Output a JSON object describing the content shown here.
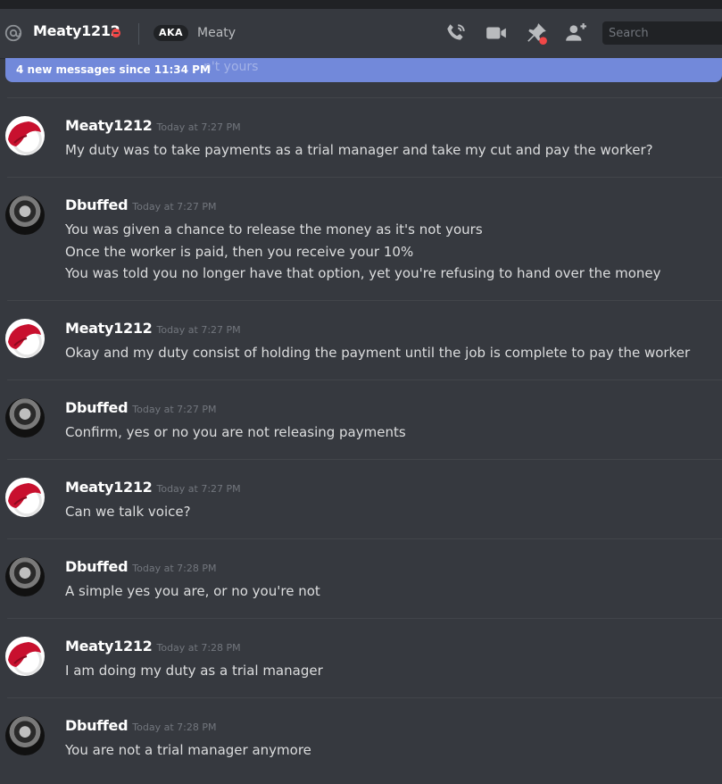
{
  "header": {
    "title": "Meaty1212",
    "aka_badge": "AKA",
    "aka_name": "Meaty",
    "status_color": "#f04747",
    "icons": [
      "at-icon",
      "start-voice-call-icon",
      "start-video-call-icon",
      "pinned-messages-icon",
      "add-friends-to-dm-icon"
    ],
    "search_placeholder": "Search"
  },
  "new_messages_bar": {
    "text": "4 new messages since 11:34 PM",
    "ghost_text": "n't yours",
    "color": "#7289da"
  },
  "messages": [
    {
      "author": "Meaty1212",
      "time": "Today at 7:27 PM",
      "avatar": "santa-hat-avatar",
      "lines": [
        "My duty was to take payments as a trial manager and take my cut and pay the worker?"
      ]
    },
    {
      "author": "Dbuffed",
      "time": "Today at 7:27 PM",
      "avatar": "bw-portrait-avatar",
      "lines": [
        "You was given a chance to release the money as it's not yours",
        "Once the worker is paid, then you receive your 10%",
        "You was told you no longer have that option, yet you're refusing to hand over the money"
      ]
    },
    {
      "author": "Meaty1212",
      "time": "Today at 7:27 PM",
      "avatar": "santa-hat-avatar",
      "lines": [
        "Okay and my duty consist of holding the payment until the job is complete to pay the worker"
      ]
    },
    {
      "author": "Dbuffed",
      "time": "Today at 7:27 PM",
      "avatar": "bw-portrait-avatar",
      "lines": [
        "Confirm, yes or no you are not releasing payments"
      ]
    },
    {
      "author": "Meaty1212",
      "time": "Today at 7:27 PM",
      "avatar": "santa-hat-avatar",
      "lines": [
        "Can we talk voice?"
      ]
    },
    {
      "author": "Dbuffed",
      "time": "Today at 7:28 PM",
      "avatar": "bw-portrait-avatar",
      "lines": [
        "A simple yes you are, or no you're not"
      ]
    },
    {
      "author": "Meaty1212",
      "time": "Today at 7:28 PM",
      "avatar": "santa-hat-avatar",
      "lines": [
        "I am doing my duty as a trial manager"
      ]
    },
    {
      "author": "Dbuffed",
      "time": "Today at 7:28 PM",
      "avatar": "bw-portrait-avatar",
      "lines": [
        "You are not a trial manager anymore"
      ]
    }
  ]
}
